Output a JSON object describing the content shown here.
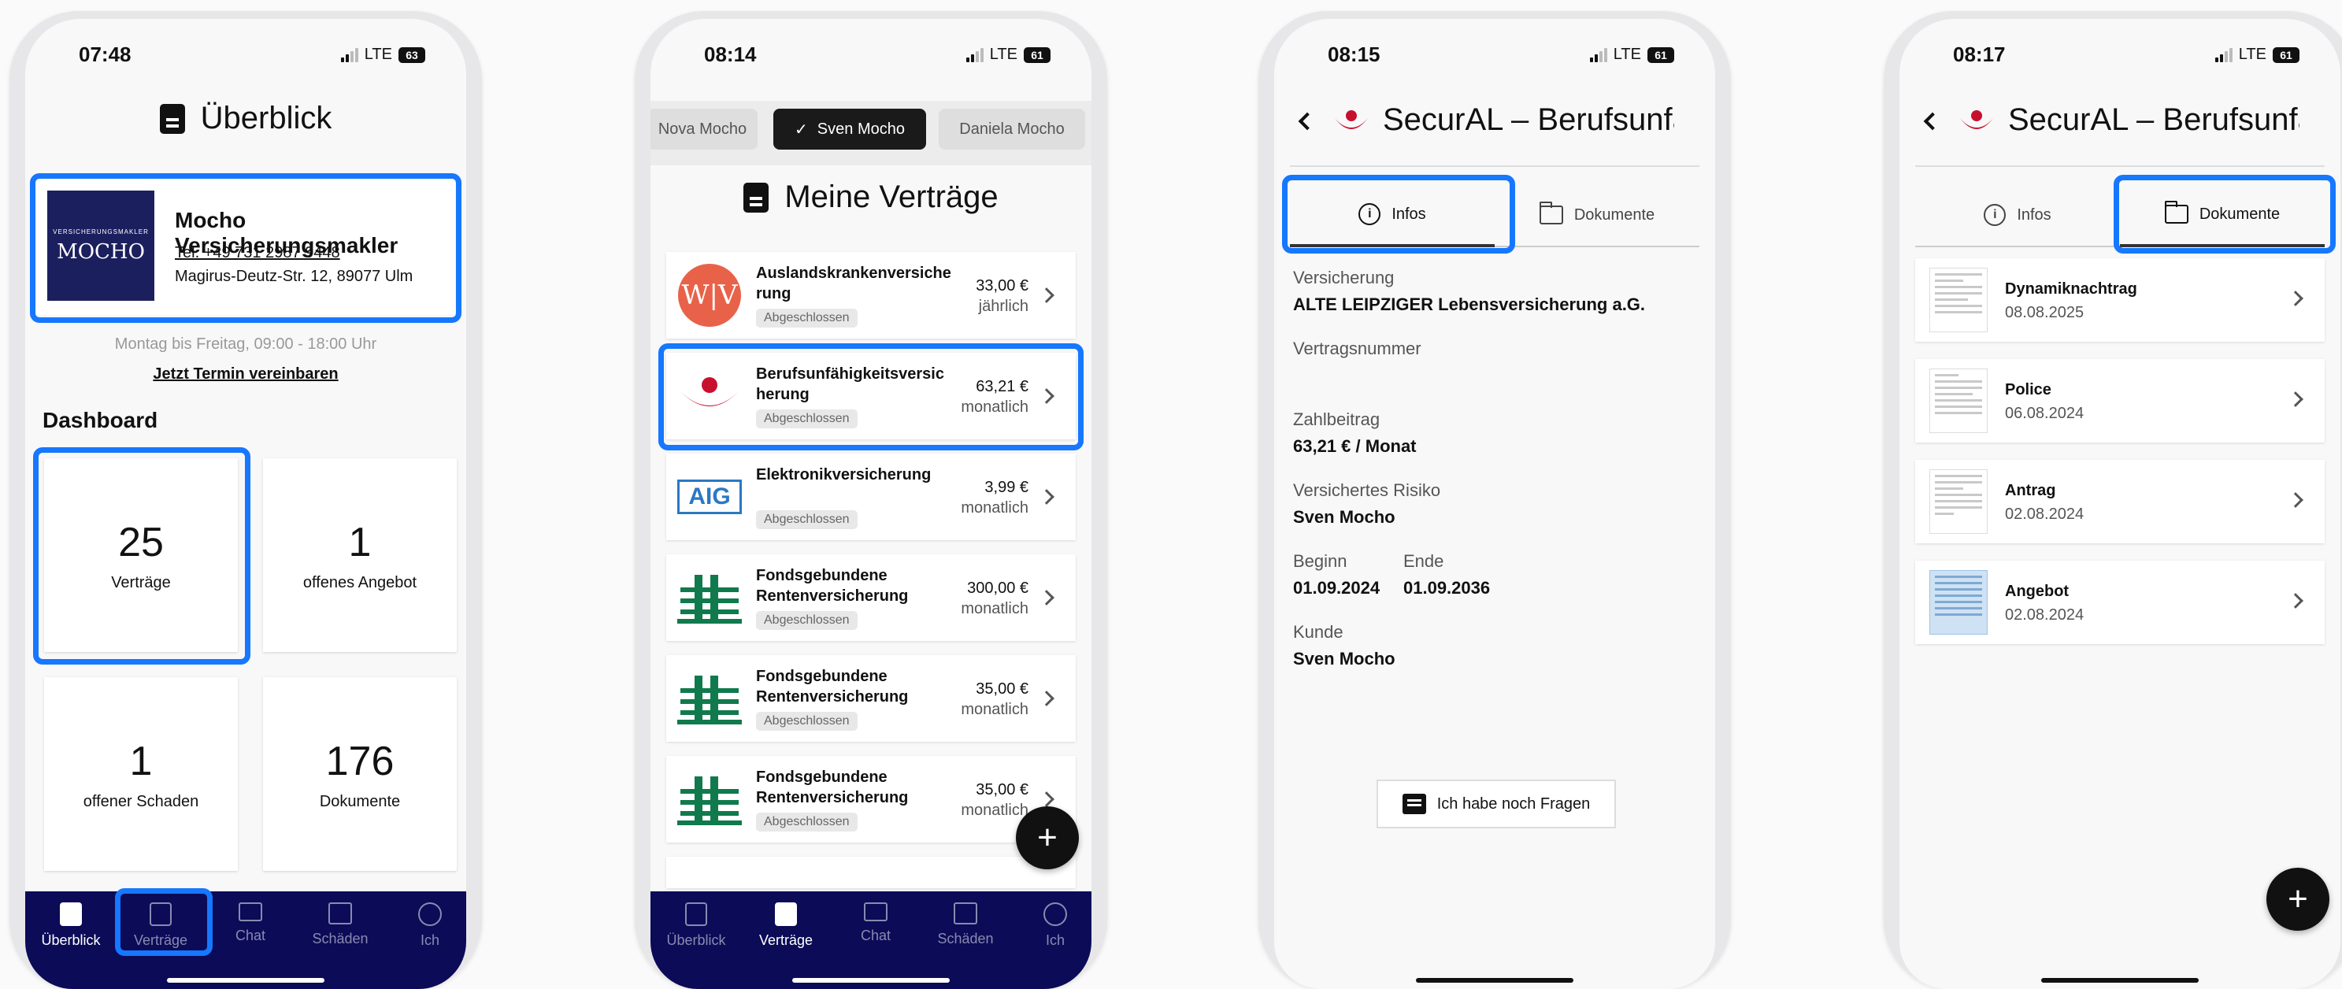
{
  "screens": {
    "overview": {
      "status": {
        "time": "07:48",
        "network": "LTE",
        "battery": "63"
      },
      "title": "Überblick",
      "broker": {
        "logo_small": "VERSICHERUNGSMAKLER",
        "logo_text": "MOCHO",
        "name": "Mocho Versicherungsmakler",
        "phone": "Tel. +49 731 2987 9448",
        "address": "Magirus-Deutz-Str. 12, 89077 Ulm"
      },
      "hours": "Montag bis Freitag, 09:00 - 18:00 Uhr",
      "appointment_link": "Jetzt Termin vereinbaren",
      "dashboard_title": "Dashboard",
      "tiles": [
        {
          "number": "25",
          "label": "Verträge"
        },
        {
          "number": "1",
          "label": "offenes Angebot"
        },
        {
          "number": "1",
          "label": "offener Schaden"
        },
        {
          "number": "176",
          "label": "Dokumente"
        }
      ]
    },
    "contracts": {
      "status": {
        "time": "08:14",
        "network": "LTE",
        "battery": "61"
      },
      "people": [
        "Nova Mocho",
        "Sven Mocho",
        "Daniela Mocho"
      ],
      "selected_person_check": "✓",
      "title": "Meine Verträge",
      "cards": [
        {
          "name": "Auslandskrankenversicherung",
          "name_lines": [
            "Auslandskrankenversiche",
            "rung"
          ],
          "status": "Abgeschlossen",
          "price": "33,00 €",
          "period": "jährlich",
          "logo": "wv-logo"
        },
        {
          "name": "Berufsunfähigkeitsversicherung",
          "name_lines": [
            "Berufsunfähigkeitsversic",
            "herung"
          ],
          "status": "Abgeschlossen",
          "price": "63,21 €",
          "period": "monatlich",
          "logo": "secural-logo"
        },
        {
          "name": "Elektronikversicherung",
          "name_lines": [
            "Elektronikversicherung",
            ""
          ],
          "status": "Abgeschlossen",
          "price": "3,99 €",
          "period": "monatlich",
          "logo": "aig-logo"
        },
        {
          "name": "Fondsgebundene Rentenversicherung",
          "name_lines": [
            "Fondsgebundene",
            "Rentenversicherung"
          ],
          "status": "Abgeschlossen",
          "price": "300,00 €",
          "period": "monatlich",
          "logo": "tower-logo"
        },
        {
          "name": "Fondsgebundene Rentenversicherung",
          "name_lines": [
            "Fondsgebundene",
            "Rentenversicherung"
          ],
          "status": "Abgeschlossen",
          "price": "35,00 €",
          "period": "monatlich",
          "logo": "tower-logo"
        },
        {
          "name": "Fondsgebundene Rentenversicherung",
          "name_lines": [
            "Fondsgebundene",
            "Rentenversicherung"
          ],
          "status": "Abgeschlossen",
          "price": "35,00 €",
          "period": "monatlich",
          "logo": "tower-logo"
        }
      ],
      "fab": "+"
    },
    "detail_info": {
      "status": {
        "time": "08:15",
        "network": "LTE",
        "battery": "61"
      },
      "title": "SecurAL – Berufsunfähigkeitsversicherung",
      "tabs": [
        "Infos",
        "Dokumente"
      ],
      "info_icon_glyph": "i",
      "fields": [
        {
          "label": "Versicherung",
          "value": "ALTE LEIPZIGER Lebensversicherung a.G."
        },
        {
          "label": "Vertragsnummer",
          "value": ""
        },
        {
          "label": "Zahlbeitrag",
          "value": "63,21 € / Monat"
        },
        {
          "label": "Versichertes Risiko",
          "value": "Sven Mocho"
        },
        {
          "label": "Beginn",
          "value": "01.09.2024"
        },
        {
          "label": "Ende",
          "value": "01.09.2036"
        },
        {
          "label": "Kunde",
          "value": "Sven Mocho"
        }
      ],
      "question_button": "Ich habe noch Fragen"
    },
    "detail_documents": {
      "status": {
        "time": "08:17",
        "network": "LTE",
        "battery": "61"
      },
      "title": "SecurAL – Berufsunfähigkeitsversicherung",
      "tabs": [
        "Infos",
        "Dokumente"
      ],
      "info_icon_glyph": "i",
      "documents": [
        {
          "name": "Dynamiknachtrag",
          "date": "08.08.2025"
        },
        {
          "name": "Police",
          "date": "06.08.2024"
        },
        {
          "name": "Antrag",
          "date": "02.08.2024"
        },
        {
          "name": "Angebot",
          "date": "02.08.2024"
        }
      ],
      "fab": "+"
    }
  },
  "nav": [
    "Überblick",
    "Verträge",
    "Chat",
    "Schäden",
    "Ich"
  ],
  "colors": {
    "highlight": "#1677ff",
    "nav_bg": "#0c0b57",
    "brand_red": "#c8102e"
  }
}
